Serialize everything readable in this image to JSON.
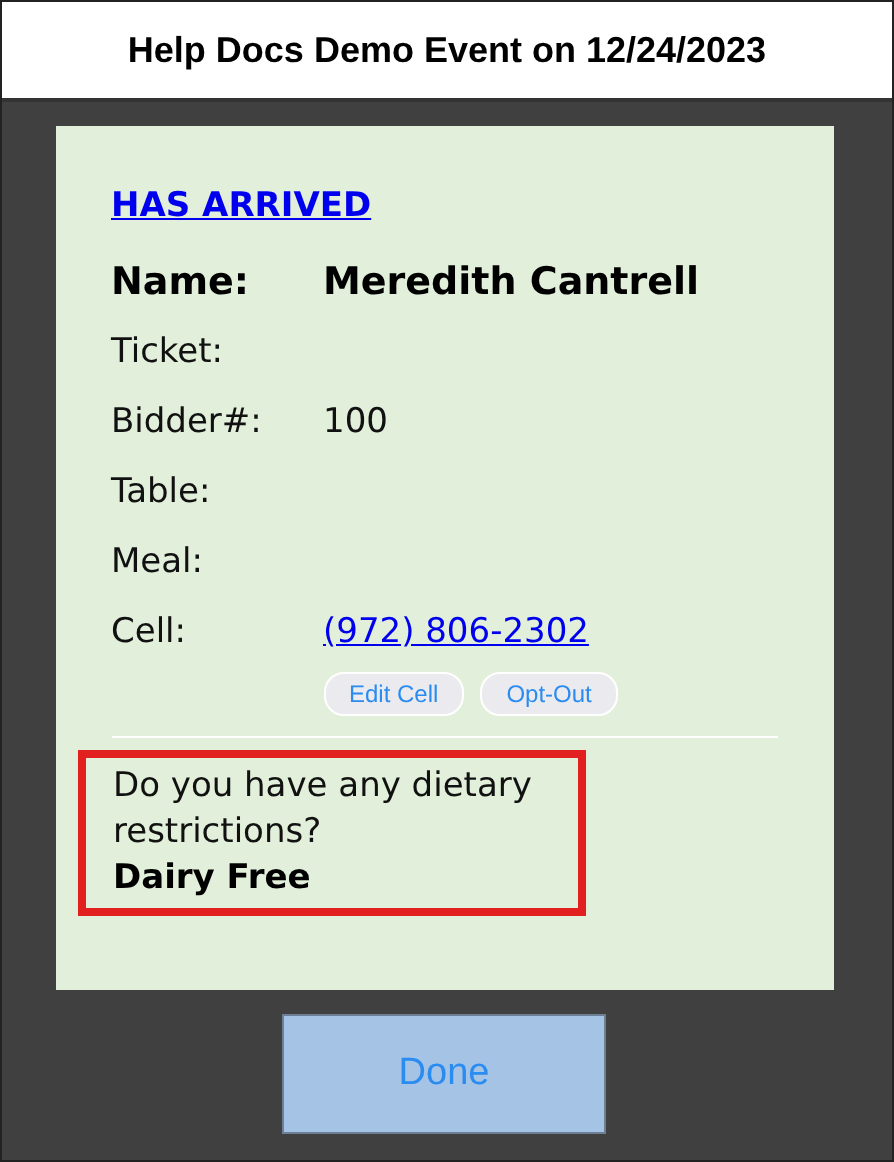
{
  "window": {
    "title": "Help Docs Demo Event on 12/24/2023"
  },
  "status_link": "HAS ARRIVED",
  "fields": [
    {
      "kind": "name",
      "label": "Name:",
      "value": "Meredith Cantrell"
    },
    {
      "kind": "text",
      "label": "Ticket:"
    },
    {
      "kind": "text",
      "label": "Bidder#:",
      "value": "100"
    },
    {
      "kind": "text",
      "label": "Table:"
    },
    {
      "kind": "text",
      "label": "Meal:"
    },
    {
      "kind": "phone",
      "label": "Cell:",
      "value": "(972) 806-2302"
    }
  ],
  "cell_buttons": [
    "Edit Cell",
    "Opt-Out"
  ],
  "question": {
    "text": "Do you have any dietary restrictions?",
    "answer": "Dairy Free"
  },
  "done_button": "Done"
}
